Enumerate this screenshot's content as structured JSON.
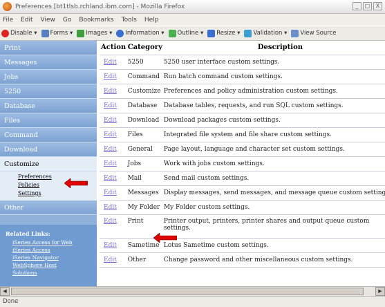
{
  "window": {
    "title": "Preferences [bt1tlsb.rchland.ibm.com] - Mozilla Firefox",
    "minimize": "_",
    "maximize": "□",
    "close": "X"
  },
  "menubar": [
    "File",
    "Edit",
    "View",
    "Go",
    "Bookmarks",
    "Tools",
    "Help"
  ],
  "toolbar": [
    {
      "label": "Disable ▾",
      "icon": "disable-icon",
      "color": "#d22"
    },
    {
      "label": "Forms ▾",
      "icon": "forms-icon",
      "color": "#5a7fc0"
    },
    {
      "label": "Images ▾",
      "icon": "images-icon",
      "color": "#3f9f3f"
    },
    {
      "label": "Information ▾",
      "icon": "information-icon",
      "color": "#3a6fd0"
    },
    {
      "label": "Outline ▾",
      "icon": "outline-icon",
      "color": "#4caf50"
    },
    {
      "label": "Resize ▾",
      "icon": "resize-icon",
      "color": "#3a6fd0"
    },
    {
      "label": "Validation ▾",
      "icon": "validation-icon",
      "color": "#3a9fd0"
    },
    {
      "label": "View Source",
      "icon": "view-source-icon",
      "color": "#6a8fc8"
    }
  ],
  "sidebar": {
    "items": [
      "Print",
      "Messages",
      "Jobs",
      "5250",
      "Database",
      "Files",
      "Command",
      "Download",
      "Customize"
    ],
    "sub_items": [
      "Preferences",
      "Policies",
      "Settings"
    ],
    "other": "Other",
    "related_title": "Related Links:",
    "related_links": [
      "iSeries Access for Web",
      "iSeries Access",
      "iSeries Navigator",
      "WebSphere Host",
      "Solutions"
    ]
  },
  "table": {
    "headers": {
      "action": "Action",
      "category": "Category",
      "description": "Description"
    },
    "rows": [
      {
        "action": "Edit",
        "category": "5250",
        "description": "5250 user interface custom settings."
      },
      {
        "action": "Edit",
        "category": "Command",
        "description": "Run batch command custom settings."
      },
      {
        "action": "Edit",
        "category": "Customize",
        "description": "Preferences and policy administration custom settings."
      },
      {
        "action": "Edit",
        "category": "Database",
        "description": "Database tables, requests, and run SQL custom settings."
      },
      {
        "action": "Edit",
        "category": "Download",
        "description": "Download packages custom settings."
      },
      {
        "action": "Edit",
        "category": "Files",
        "description": "Integrated file system and file share custom settings."
      },
      {
        "action": "Edit",
        "category": "General",
        "description": "Page layout, language and character set custom settings."
      },
      {
        "action": "Edit",
        "category": "Jobs",
        "description": "Work with jobs custom settings."
      },
      {
        "action": "Edit",
        "category": "Mail",
        "description": "Send mail custom settings."
      },
      {
        "action": "Edit",
        "category": "Messages",
        "description": "Display messages, send messages, and message queue custom settings."
      },
      {
        "action": "Edit",
        "category": "My Folder",
        "description": "My Folder custom settings."
      },
      {
        "action": "Edit",
        "category": "Print",
        "description": "Printer output, printers, printer shares and output queue custom settings."
      },
      {
        "action": "Edit",
        "category": "Sametime",
        "description": "Lotus Sametime custom settings."
      },
      {
        "action": "Edit",
        "category": "Other",
        "description": "Change password and other miscellaneous custom settings."
      }
    ]
  },
  "status": "Done",
  "colors": {
    "arrow": "#e00000",
    "sidebar": "#8fb1da",
    "link": "#7c6ad6"
  }
}
